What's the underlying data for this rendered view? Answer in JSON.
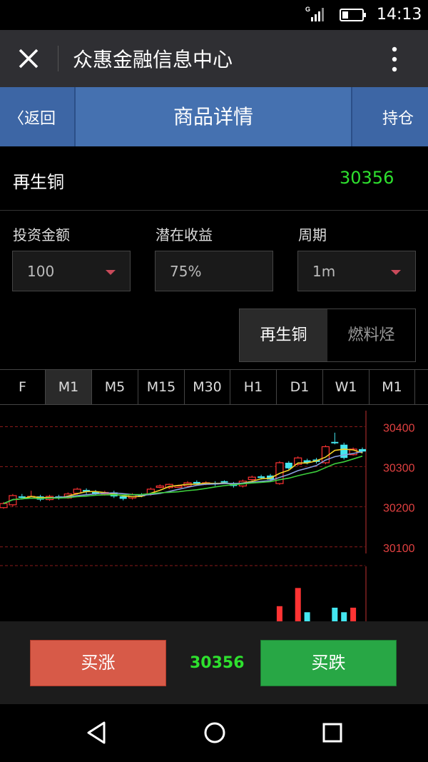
{
  "status_bar": {
    "time": "14:13",
    "network": "G"
  },
  "topbar": {
    "title": "众惠金融信息中心"
  },
  "navbar": {
    "back_label": "〈返回",
    "title": "商品详情",
    "hold_label": "持仓"
  },
  "product": {
    "name": "再生铜",
    "price": "30356"
  },
  "form": {
    "amount": {
      "label": "投资金额",
      "value": "100"
    },
    "profit": {
      "label": "潜在收益",
      "value": "75%"
    },
    "period": {
      "label": "周期",
      "value": "1m"
    }
  },
  "product_toggle": {
    "active": "再生铜",
    "inactive": "燃料烃"
  },
  "tabs": [
    "F",
    "M1",
    "M5",
    "M15",
    "M30",
    "H1",
    "D1",
    "W1",
    "M1"
  ],
  "active_tab_index": 1,
  "colors": {
    "up": "#ff3333",
    "down": "#44e6f0",
    "price_green": "#2ee02e",
    "header_blue": "#4571b0"
  },
  "chart_data": {
    "type": "candlestick",
    "y_ticks": [
      "30400",
      "30300",
      "30200",
      "30100"
    ],
    "ylim": [
      30080,
      30440
    ],
    "candles": [
      {
        "o": 30198,
        "c": 30208,
        "h": 30212,
        "l": 30195
      },
      {
        "o": 30205,
        "c": 30228,
        "h": 30232,
        "l": 30200
      },
      {
        "o": 30226,
        "c": 30224,
        "h": 30232,
        "l": 30220
      },
      {
        "o": 30224,
        "c": 30226,
        "h": 30240,
        "l": 30220
      },
      {
        "o": 30226,
        "c": 30218,
        "h": 30230,
        "l": 30214
      },
      {
        "o": 30218,
        "c": 30226,
        "h": 30230,
        "l": 30215
      },
      {
        "o": 30226,
        "c": 30222,
        "h": 30230,
        "l": 30218
      },
      {
        "o": 30222,
        "c": 30232,
        "h": 30236,
        "l": 30220
      },
      {
        "o": 30234,
        "c": 30244,
        "h": 30248,
        "l": 30230
      },
      {
        "o": 30242,
        "c": 30238,
        "h": 30246,
        "l": 30232
      },
      {
        "o": 30238,
        "c": 30232,
        "h": 30242,
        "l": 30228
      },
      {
        "o": 30232,
        "c": 30236,
        "h": 30240,
        "l": 30228
      },
      {
        "o": 30236,
        "c": 30226,
        "h": 30240,
        "l": 30222
      },
      {
        "o": 30226,
        "c": 30220,
        "h": 30230,
        "l": 30216
      },
      {
        "o": 30222,
        "c": 30230,
        "h": 30234,
        "l": 30218
      },
      {
        "o": 30230,
        "c": 30228,
        "h": 30234,
        "l": 30224
      },
      {
        "o": 30232,
        "c": 30244,
        "h": 30248,
        "l": 30228
      },
      {
        "o": 30250,
        "c": 30252,
        "h": 30256,
        "l": 30246
      },
      {
        "o": 30248,
        "c": 30256,
        "h": 30258,
        "l": 30244
      },
      {
        "o": 30252,
        "c": 30252,
        "h": 30255,
        "l": 30249
      },
      {
        "o": 30252,
        "c": 30260,
        "h": 30264,
        "l": 30248
      },
      {
        "o": 30262,
        "c": 30258,
        "h": 30266,
        "l": 30254
      },
      {
        "o": 30258,
        "c": 30260,
        "h": 30264,
        "l": 30254
      },
      {
        "o": 30260,
        "c": 30256,
        "h": 30264,
        "l": 30252
      },
      {
        "o": 30264,
        "c": 30262,
        "h": 30266,
        "l": 30258
      },
      {
        "o": 30258,
        "c": 30252,
        "h": 30262,
        "l": 30248
      },
      {
        "o": 30252,
        "c": 30264,
        "h": 30268,
        "l": 30248
      },
      {
        "o": 30268,
        "c": 30274,
        "h": 30278,
        "l": 30264
      },
      {
        "o": 30276,
        "c": 30272,
        "h": 30280,
        "l": 30268
      },
      {
        "o": 30278,
        "c": 30268,
        "h": 30282,
        "l": 30264
      },
      {
        "o": 30258,
        "c": 30310,
        "h": 30314,
        "l": 30255
      },
      {
        "o": 30310,
        "c": 30296,
        "h": 30314,
        "l": 30292
      },
      {
        "o": 30306,
        "c": 30322,
        "h": 30326,
        "l": 30302
      },
      {
        "o": 30316,
        "c": 30310,
        "h": 30320,
        "l": 30306
      },
      {
        "o": 30318,
        "c": 30312,
        "h": 30322,
        "l": 30308
      },
      {
        "o": 30310,
        "c": 30350,
        "h": 30354,
        "l": 30306
      },
      {
        "o": 30362,
        "c": 30360,
        "h": 30385,
        "l": 30356
      },
      {
        "o": 30355,
        "c": 30322,
        "h": 30360,
        "l": 30318
      },
      {
        "o": 30330,
        "c": 30344,
        "h": 30348,
        "l": 30328
      },
      {
        "o": 30344,
        "c": 30338,
        "h": 30348,
        "l": 30334
      }
    ],
    "volumes": [
      0,
      0,
      0,
      0,
      0,
      0,
      0,
      0,
      0,
      0,
      0,
      0,
      0,
      0,
      0,
      0,
      0,
      0,
      0,
      0,
      0,
      0,
      0,
      0,
      0,
      0,
      0,
      0,
      0,
      0,
      20,
      0,
      44,
      12,
      0,
      0,
      18,
      12,
      18,
      0
    ]
  },
  "trade": {
    "up_label": "买涨",
    "price": "30356",
    "down_label": "买跌"
  }
}
